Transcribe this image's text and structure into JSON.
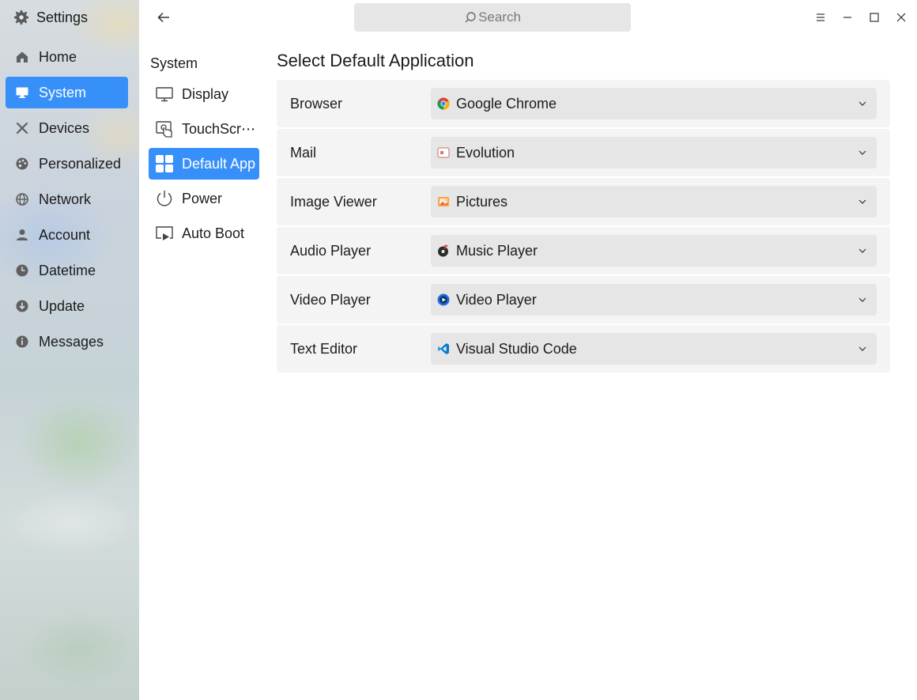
{
  "window": {
    "title": "Settings"
  },
  "sidebar": {
    "items": [
      {
        "label": "Home",
        "icon": "home-icon"
      },
      {
        "label": "System",
        "icon": "monitor-icon",
        "active": true
      },
      {
        "label": "Devices",
        "icon": "tools-icon"
      },
      {
        "label": "Personalized",
        "icon": "palette-icon"
      },
      {
        "label": "Network",
        "icon": "globe-icon"
      },
      {
        "label": "Account",
        "icon": "user-icon"
      },
      {
        "label": "Datetime",
        "icon": "clock-icon"
      },
      {
        "label": "Update",
        "icon": "update-icon"
      },
      {
        "label": "Messages",
        "icon": "info-icon"
      }
    ]
  },
  "search": {
    "placeholder": "Search"
  },
  "section": {
    "title": "System",
    "items": [
      {
        "label": "Display",
        "icon": "display-icon"
      },
      {
        "label": "TouchScr⋯",
        "icon": "touchscreen-icon"
      },
      {
        "label": "Default App",
        "icon": "apps-grid-icon",
        "active": true
      },
      {
        "label": "Power",
        "icon": "power-icon"
      },
      {
        "label": "Auto Boot",
        "icon": "autoboot-icon"
      }
    ]
  },
  "main": {
    "title": "Select Default Application",
    "rows": [
      {
        "label": "Browser",
        "value": "Google Chrome",
        "icon": "chrome-icon"
      },
      {
        "label": "Mail",
        "value": "Evolution",
        "icon": "evolution-icon"
      },
      {
        "label": "Image Viewer",
        "value": "Pictures",
        "icon": "pictures-icon"
      },
      {
        "label": "Audio Player",
        "value": "Music Player",
        "icon": "music-player-icon"
      },
      {
        "label": "Video Player",
        "value": "Video Player",
        "icon": "video-player-icon"
      },
      {
        "label": "Text Editor",
        "value": "Visual Studio Code",
        "icon": "vscode-icon"
      }
    ]
  },
  "colors": {
    "accent": "#3790fa",
    "row_bg": "#f4f4f4",
    "select_bg": "#e6e6e6"
  }
}
